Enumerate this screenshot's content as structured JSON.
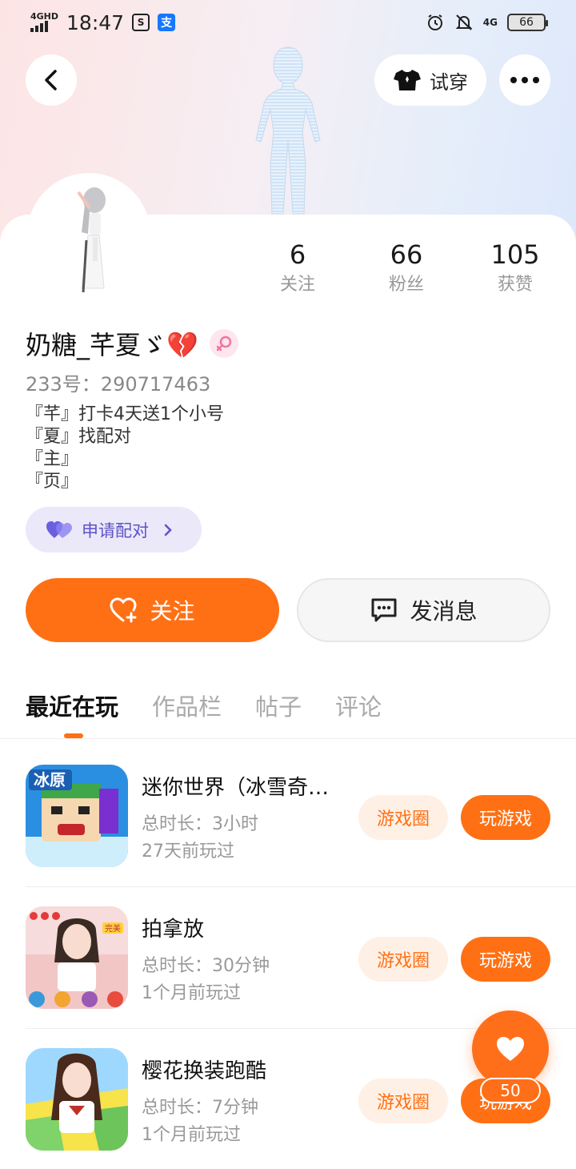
{
  "status_bar": {
    "network": "4GHD",
    "time": "18:47",
    "right_network": "4G",
    "battery": "66"
  },
  "header": {
    "tryon_label": "试穿"
  },
  "stats": [
    {
      "value": "6",
      "label": "关注"
    },
    {
      "value": "66",
      "label": "粉丝"
    },
    {
      "value": "105",
      "label": "获赞"
    }
  ],
  "profile": {
    "username": "奶糖_芊夏ゞ💔",
    "uid": "233号：290717463",
    "bio": [
      "『芊』打卡4天送1个小号",
      "『夏』找配对",
      "『主』",
      "『页』"
    ],
    "pair_label": "申请配对"
  },
  "actions": {
    "follow_label": "关注",
    "message_label": "发消息"
  },
  "tabs": [
    {
      "label": "最近在玩",
      "active": true
    },
    {
      "label": "作品栏",
      "active": false
    },
    {
      "label": "帖子",
      "active": false
    },
    {
      "label": "评论",
      "active": false
    }
  ],
  "games": [
    {
      "title": "迷你世界（冰雪奇…",
      "duration": "总时长：3小时",
      "last_played": "27天前玩过",
      "circle_label": "游戏圈",
      "play_label": "玩游戏",
      "icon_text": "冰原"
    },
    {
      "title": "拍拿放",
      "duration": "总时长：30分钟",
      "last_played": "1个月前玩过",
      "circle_label": "游戏圈",
      "play_label": "玩游戏",
      "icon_text": "完美"
    },
    {
      "title": "樱花换装跑酷",
      "duration": "总时长：7分钟",
      "last_played": "1个月前玩过",
      "circle_label": "游戏圈",
      "play_label": "玩游戏",
      "icon_text": ""
    }
  ],
  "float_like": {
    "count": "50"
  },
  "colors": {
    "accent": "#ff7014",
    "pair_bg": "#ebe8fa",
    "pair_text": "#5d53c7"
  }
}
